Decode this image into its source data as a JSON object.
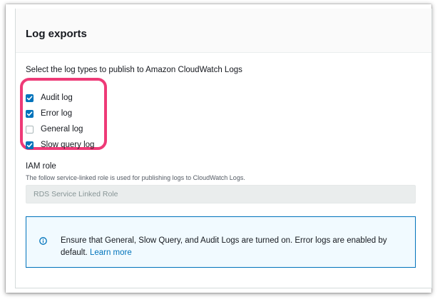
{
  "panel": {
    "title": "Log exports",
    "description": "Select the log types to publish to Amazon CloudWatch Logs"
  },
  "log_types": [
    {
      "label": "Audit log",
      "checked": true
    },
    {
      "label": "Error log",
      "checked": true
    },
    {
      "label": "General log",
      "checked": false
    },
    {
      "label": "Slow query log",
      "checked": true
    }
  ],
  "iam_role": {
    "label": "IAM role",
    "help_text": "The follow service-linked role is used for publishing logs to CloudWatch Logs.",
    "value": "RDS Service Linked Role"
  },
  "info_alert": {
    "icon": "info-icon",
    "text": "Ensure that General, Slow Query, and Audit Logs are turned on. Error logs are enabled by default.",
    "link_text": "Learn more"
  },
  "colors": {
    "accent": "#0073bb",
    "highlight": "#ee3a77",
    "alert_background": "#f1faff"
  }
}
